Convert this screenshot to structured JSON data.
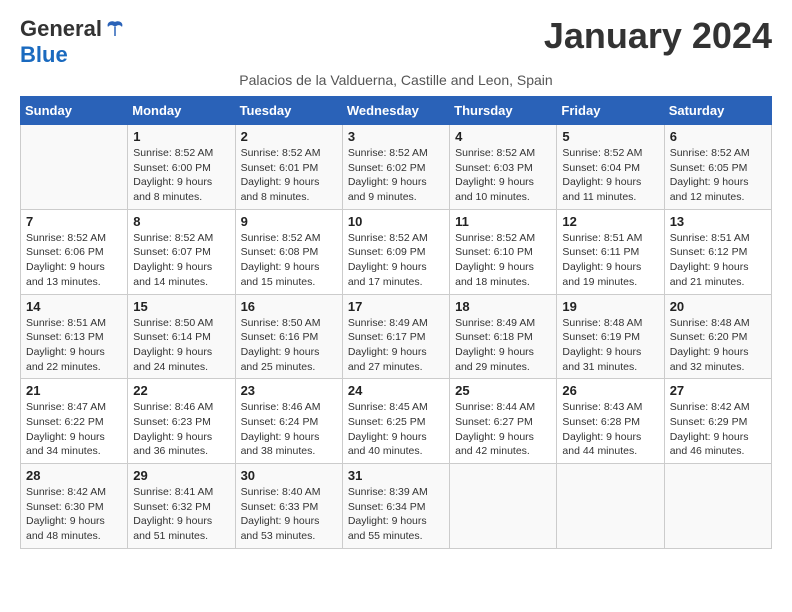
{
  "header": {
    "logo_general": "General",
    "logo_blue": "Blue",
    "month_year": "January 2024",
    "subtitle": "Palacios de la Valduerna, Castille and Leon, Spain"
  },
  "days_of_week": [
    "Sunday",
    "Monday",
    "Tuesday",
    "Wednesday",
    "Thursday",
    "Friday",
    "Saturday"
  ],
  "weeks": [
    [
      {
        "day": "",
        "lines": []
      },
      {
        "day": "1",
        "lines": [
          "Sunrise: 8:52 AM",
          "Sunset: 6:00 PM",
          "Daylight: 9 hours",
          "and 8 minutes."
        ]
      },
      {
        "day": "2",
        "lines": [
          "Sunrise: 8:52 AM",
          "Sunset: 6:01 PM",
          "Daylight: 9 hours",
          "and 8 minutes."
        ]
      },
      {
        "day": "3",
        "lines": [
          "Sunrise: 8:52 AM",
          "Sunset: 6:02 PM",
          "Daylight: 9 hours",
          "and 9 minutes."
        ]
      },
      {
        "day": "4",
        "lines": [
          "Sunrise: 8:52 AM",
          "Sunset: 6:03 PM",
          "Daylight: 9 hours",
          "and 10 minutes."
        ]
      },
      {
        "day": "5",
        "lines": [
          "Sunrise: 8:52 AM",
          "Sunset: 6:04 PM",
          "Daylight: 9 hours",
          "and 11 minutes."
        ]
      },
      {
        "day": "6",
        "lines": [
          "Sunrise: 8:52 AM",
          "Sunset: 6:05 PM",
          "Daylight: 9 hours",
          "and 12 minutes."
        ]
      }
    ],
    [
      {
        "day": "7",
        "lines": [
          "Sunrise: 8:52 AM",
          "Sunset: 6:06 PM",
          "Daylight: 9 hours",
          "and 13 minutes."
        ]
      },
      {
        "day": "8",
        "lines": [
          "Sunrise: 8:52 AM",
          "Sunset: 6:07 PM",
          "Daylight: 9 hours",
          "and 14 minutes."
        ]
      },
      {
        "day": "9",
        "lines": [
          "Sunrise: 8:52 AM",
          "Sunset: 6:08 PM",
          "Daylight: 9 hours",
          "and 15 minutes."
        ]
      },
      {
        "day": "10",
        "lines": [
          "Sunrise: 8:52 AM",
          "Sunset: 6:09 PM",
          "Daylight: 9 hours",
          "and 17 minutes."
        ]
      },
      {
        "day": "11",
        "lines": [
          "Sunrise: 8:52 AM",
          "Sunset: 6:10 PM",
          "Daylight: 9 hours",
          "and 18 minutes."
        ]
      },
      {
        "day": "12",
        "lines": [
          "Sunrise: 8:51 AM",
          "Sunset: 6:11 PM",
          "Daylight: 9 hours",
          "and 19 minutes."
        ]
      },
      {
        "day": "13",
        "lines": [
          "Sunrise: 8:51 AM",
          "Sunset: 6:12 PM",
          "Daylight: 9 hours",
          "and 21 minutes."
        ]
      }
    ],
    [
      {
        "day": "14",
        "lines": [
          "Sunrise: 8:51 AM",
          "Sunset: 6:13 PM",
          "Daylight: 9 hours",
          "and 22 minutes."
        ]
      },
      {
        "day": "15",
        "lines": [
          "Sunrise: 8:50 AM",
          "Sunset: 6:14 PM",
          "Daylight: 9 hours",
          "and 24 minutes."
        ]
      },
      {
        "day": "16",
        "lines": [
          "Sunrise: 8:50 AM",
          "Sunset: 6:16 PM",
          "Daylight: 9 hours",
          "and 25 minutes."
        ]
      },
      {
        "day": "17",
        "lines": [
          "Sunrise: 8:49 AM",
          "Sunset: 6:17 PM",
          "Daylight: 9 hours",
          "and 27 minutes."
        ]
      },
      {
        "day": "18",
        "lines": [
          "Sunrise: 8:49 AM",
          "Sunset: 6:18 PM",
          "Daylight: 9 hours",
          "and 29 minutes."
        ]
      },
      {
        "day": "19",
        "lines": [
          "Sunrise: 8:48 AM",
          "Sunset: 6:19 PM",
          "Daylight: 9 hours",
          "and 31 minutes."
        ]
      },
      {
        "day": "20",
        "lines": [
          "Sunrise: 8:48 AM",
          "Sunset: 6:20 PM",
          "Daylight: 9 hours",
          "and 32 minutes."
        ]
      }
    ],
    [
      {
        "day": "21",
        "lines": [
          "Sunrise: 8:47 AM",
          "Sunset: 6:22 PM",
          "Daylight: 9 hours",
          "and 34 minutes."
        ]
      },
      {
        "day": "22",
        "lines": [
          "Sunrise: 8:46 AM",
          "Sunset: 6:23 PM",
          "Daylight: 9 hours",
          "and 36 minutes."
        ]
      },
      {
        "day": "23",
        "lines": [
          "Sunrise: 8:46 AM",
          "Sunset: 6:24 PM",
          "Daylight: 9 hours",
          "and 38 minutes."
        ]
      },
      {
        "day": "24",
        "lines": [
          "Sunrise: 8:45 AM",
          "Sunset: 6:25 PM",
          "Daylight: 9 hours",
          "and 40 minutes."
        ]
      },
      {
        "day": "25",
        "lines": [
          "Sunrise: 8:44 AM",
          "Sunset: 6:27 PM",
          "Daylight: 9 hours",
          "and 42 minutes."
        ]
      },
      {
        "day": "26",
        "lines": [
          "Sunrise: 8:43 AM",
          "Sunset: 6:28 PM",
          "Daylight: 9 hours",
          "and 44 minutes."
        ]
      },
      {
        "day": "27",
        "lines": [
          "Sunrise: 8:42 AM",
          "Sunset: 6:29 PM",
          "Daylight: 9 hours",
          "and 46 minutes."
        ]
      }
    ],
    [
      {
        "day": "28",
        "lines": [
          "Sunrise: 8:42 AM",
          "Sunset: 6:30 PM",
          "Daylight: 9 hours",
          "and 48 minutes."
        ]
      },
      {
        "day": "29",
        "lines": [
          "Sunrise: 8:41 AM",
          "Sunset: 6:32 PM",
          "Daylight: 9 hours",
          "and 51 minutes."
        ]
      },
      {
        "day": "30",
        "lines": [
          "Sunrise: 8:40 AM",
          "Sunset: 6:33 PM",
          "Daylight: 9 hours",
          "and 53 minutes."
        ]
      },
      {
        "day": "31",
        "lines": [
          "Sunrise: 8:39 AM",
          "Sunset: 6:34 PM",
          "Daylight: 9 hours",
          "and 55 minutes."
        ]
      },
      {
        "day": "",
        "lines": []
      },
      {
        "day": "",
        "lines": []
      },
      {
        "day": "",
        "lines": []
      }
    ]
  ]
}
